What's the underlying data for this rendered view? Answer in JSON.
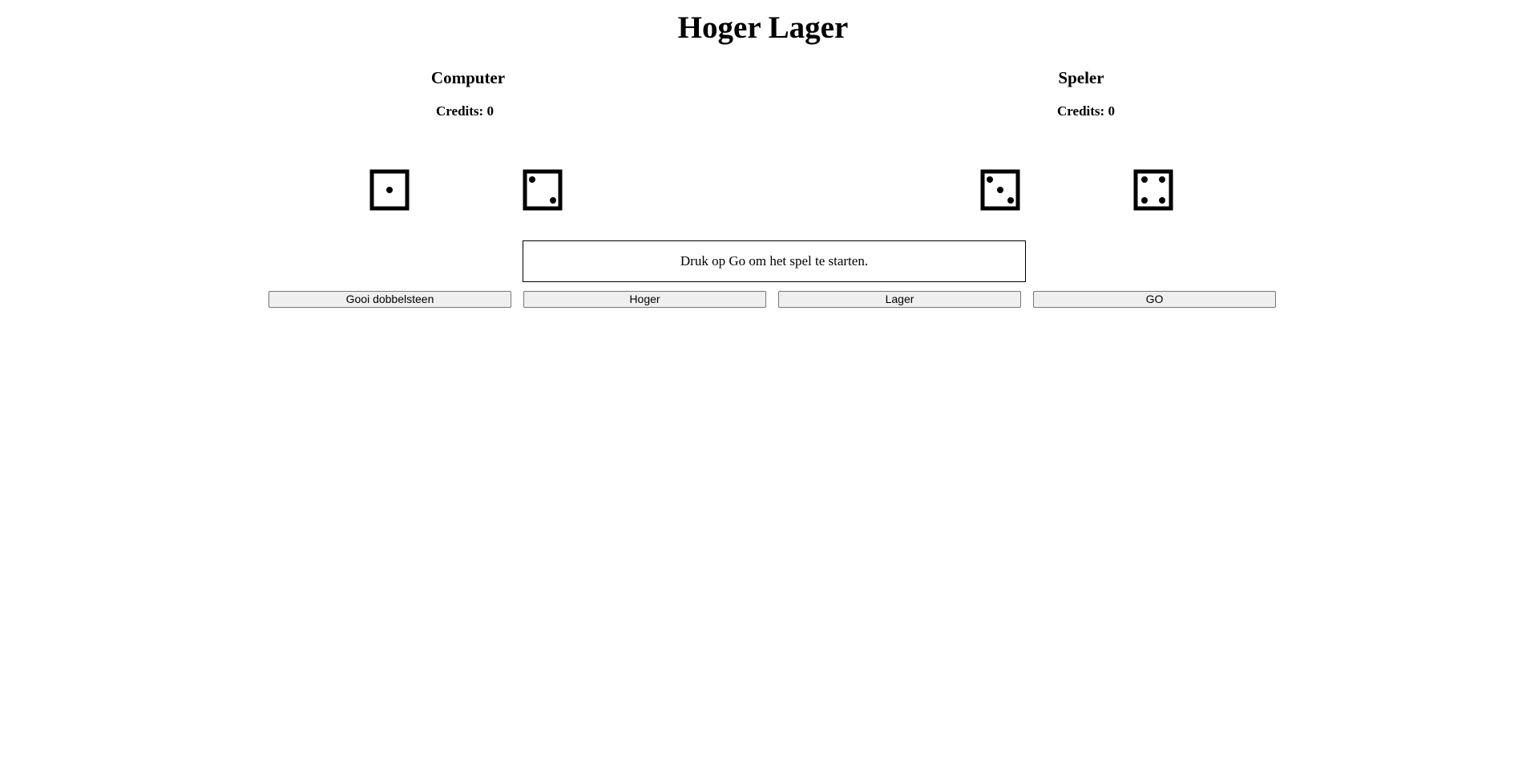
{
  "title": "Hoger Lager",
  "computer": {
    "name": "Computer",
    "credits_label": "Credits:",
    "credits": 0,
    "dice": [
      1,
      2
    ]
  },
  "player": {
    "name": "Speler",
    "credits_label": "Credits:",
    "credits": 0,
    "dice": [
      3,
      4
    ]
  },
  "message": "Druk op Go om het spel te starten.",
  "buttons": {
    "roll": "Gooi dobbelsteen",
    "higher": "Hoger",
    "lower": "Lager",
    "go": "GO"
  }
}
